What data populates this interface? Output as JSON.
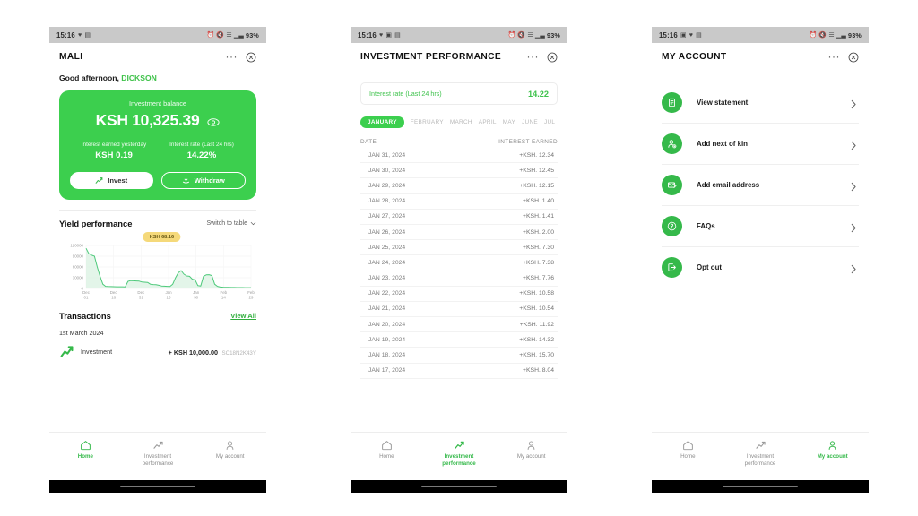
{
  "colors": {
    "brand_green": "#3ccf4e",
    "icon_green": "#35b94a",
    "accent_green": "#2fae3c",
    "tooltip_yellow": "#f5d97a",
    "statusbar_gray": "#c9c9c9"
  },
  "status_bar": {
    "time": "15:16",
    "left_icons": [
      "heart-icon",
      "picture-icon",
      "message-icon"
    ],
    "right_icons": [
      "alarm-icon",
      "mute-icon",
      "wifi-icon",
      "signal-icon",
      "signal2-icon"
    ],
    "battery": "93%"
  },
  "screen1": {
    "title": "MALI",
    "more_label": "···",
    "greeting_prefix": "Good afternoon,",
    "greeting_name": "DICKSON",
    "balance_card": {
      "label": "Investment balance",
      "amount": "KSH 10,325.39",
      "eye_icon": "eye-icon",
      "stat1_label": "Interest earned yesterday",
      "stat1_value": "KSH 0.19",
      "stat2_label": "Interest rate (Last 24 hrs)",
      "stat2_value": "14.22%",
      "invest_label": "Invest",
      "withdraw_label": "Withdraw"
    },
    "yield": {
      "title": "Yield performance",
      "switch_label": "Switch to table"
    },
    "transactions": {
      "title": "Transactions",
      "view_all": "View All",
      "date_group": "1st March 2024",
      "rows": [
        {
          "name": "Investment",
          "amount": "+ KSH 10,000.00",
          "reference": "SC18N2K43Y"
        }
      ]
    }
  },
  "screen2": {
    "title": "INVESTMENT PERFORMANCE",
    "more_label": "···",
    "rate_box": {
      "label": "Interest rate (Last 24 hrs)",
      "value": "14.22"
    },
    "months": [
      "JANUARY",
      "FEBRUARY",
      "MARCH",
      "APRIL",
      "MAY",
      "JUNE",
      "JUL"
    ],
    "active_month": "JANUARY",
    "table": {
      "col_date": "DATE",
      "col_interest": "INTEREST EARNED",
      "rows": [
        {
          "date": "JAN 31, 2024",
          "amount": "+KSH. 12.34"
        },
        {
          "date": "JAN 30, 2024",
          "amount": "+KSH. 12.45"
        },
        {
          "date": "JAN 29, 2024",
          "amount": "+KSH. 12.15"
        },
        {
          "date": "JAN 28, 2024",
          "amount": "+KSH. 1.40"
        },
        {
          "date": "JAN 27, 2024",
          "amount": "+KSH. 1.41"
        },
        {
          "date": "JAN 26, 2024",
          "amount": "+KSH. 2.00"
        },
        {
          "date": "JAN 25, 2024",
          "amount": "+KSH. 7.30"
        },
        {
          "date": "JAN 24, 2024",
          "amount": "+KSH. 7.38"
        },
        {
          "date": "JAN 23, 2024",
          "amount": "+KSH. 7.76"
        },
        {
          "date": "JAN 22, 2024",
          "amount": "+KSH. 10.58"
        },
        {
          "date": "JAN 21, 2024",
          "amount": "+KSH. 10.54"
        },
        {
          "date": "JAN 20, 2024",
          "amount": "+KSH. 11.92"
        },
        {
          "date": "JAN 19, 2024",
          "amount": "+KSH. 14.32"
        },
        {
          "date": "JAN 18, 2024",
          "amount": "+KSH. 15.70"
        },
        {
          "date": "JAN 17, 2024",
          "amount": "+KSH. 8.04"
        }
      ]
    }
  },
  "screen3": {
    "title": "MY ACCOUNT",
    "more_label": "···",
    "items": [
      {
        "label": "View statement",
        "icon": "document-icon"
      },
      {
        "label": "Add next of kin",
        "icon": "add-person-icon"
      },
      {
        "label": "Add email address",
        "icon": "mail-plus-icon"
      },
      {
        "label": "FAQs",
        "icon": "question-circle-icon"
      },
      {
        "label": "Opt out",
        "icon": "logout-icon"
      }
    ]
  },
  "bottom_nav": {
    "items": [
      {
        "label": "Home",
        "icon": "home-icon"
      },
      {
        "label": "Investment performance",
        "icon": "growth-icon"
      },
      {
        "label": "My account",
        "icon": "person-icon"
      }
    ],
    "active": {
      "screen1": "Home",
      "screen2": "Investment performance",
      "screen3": "My account"
    }
  },
  "chart_data": {
    "type": "line",
    "title": "Yield performance",
    "xlabel": "",
    "ylabel": "",
    "ylim": [
      0,
      120000
    ],
    "yticks": [
      0,
      30000,
      60000,
      90000,
      120000
    ],
    "ytick_labels": [
      "0",
      "30000",
      "60000",
      "90000",
      "120000"
    ],
    "xtick_labels": [
      "Dec 01",
      "Dec 16",
      "Dec 31",
      "Jan 15",
      "Jan 30",
      "Feb 14",
      "Feb 29"
    ],
    "xtick_lines": [
      [
        "Dec",
        "01"
      ],
      [
        "Dec",
        "16"
      ],
      [
        "Dec",
        "31"
      ],
      [
        "Jan",
        "15"
      ],
      [
        "Jan",
        "30"
      ],
      [
        "Feb",
        "14"
      ],
      [
        "Feb",
        "29"
      ]
    ],
    "grid": true,
    "legend": null,
    "annotation": "KSH 68.16",
    "line_color": "#4dc97a",
    "fill_color": "#d9f2e2",
    "series": [
      {
        "name": "Yield",
        "values": [
          112000,
          97000,
          93000,
          90000,
          60000,
          34000,
          12000,
          6000,
          5500,
          5200,
          5000,
          4800,
          4700,
          4600,
          4500,
          20000,
          22000,
          21500,
          21000,
          20500,
          18000,
          17500,
          17000,
          12000,
          11000,
          10500,
          9000,
          7000,
          6500,
          6000,
          5500,
          12000,
          30000,
          44000,
          50000,
          40000,
          35000,
          34000,
          26000,
          24000,
          8000,
          7000,
          34000,
          38000,
          38500,
          36000,
          12000,
          6000,
          4000,
          3500,
          3200,
          3000,
          2800,
          2700,
          2600,
          2500,
          2400,
          2300,
          2200,
          2100
        ]
      }
    ]
  }
}
